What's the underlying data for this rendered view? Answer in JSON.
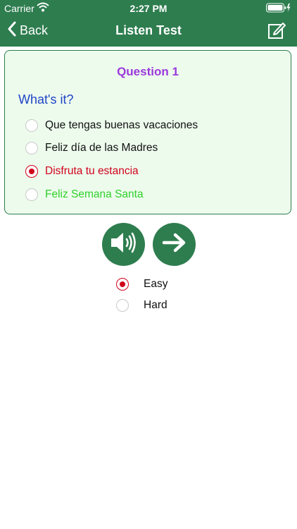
{
  "status": {
    "carrier": "Carrier",
    "time": "2:27 PM"
  },
  "nav": {
    "back_label": "Back",
    "title": "Listen Test"
  },
  "question": {
    "title": "Question 1",
    "prompt": "What's it?",
    "options": [
      {
        "label": "Que tengas buenas vacaciones",
        "color": "#111111",
        "selected": false
      },
      {
        "label": "Feliz día de las Madres",
        "color": "#111111",
        "selected": false
      },
      {
        "label": "Disfruta tu estancia",
        "color": "#d0021b",
        "selected": true
      },
      {
        "label": "Feliz Semana Santa",
        "color": "#2fd12a",
        "selected": false
      }
    ]
  },
  "controls": {
    "speaker_icon": "speaker-icon",
    "next_icon": "arrow-right-icon"
  },
  "mode": {
    "options": [
      {
        "label": "Easy",
        "selected": true
      },
      {
        "label": "Hard",
        "selected": false
      }
    ]
  },
  "colors": {
    "primary": "#2e7d4f",
    "card_bg": "#edfbed",
    "title": "#9b39db",
    "prompt": "#1f44c7",
    "wrong": "#d0021b",
    "correct": "#2fd12a"
  }
}
